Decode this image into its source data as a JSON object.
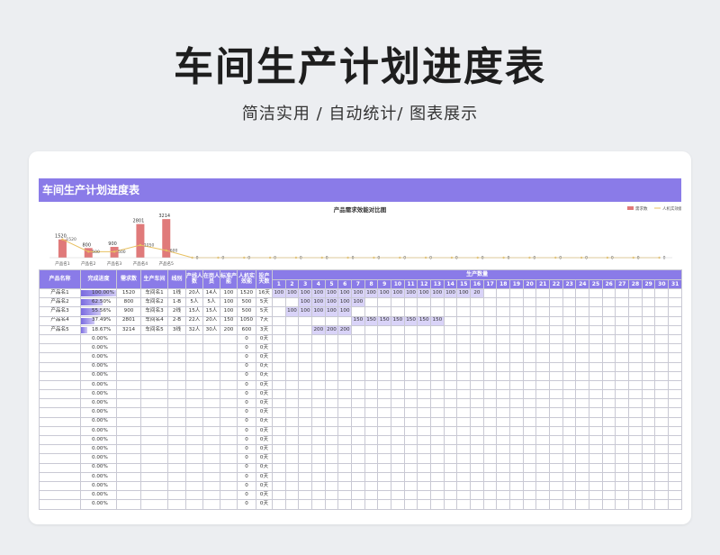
{
  "header": {
    "title": "车间生产计划进度表",
    "subtitle": "简洁实用 / 自动统计/ 图表展示"
  },
  "sheet": {
    "title": "车间生产计划进度表"
  },
  "chart_data": {
    "type": "bar",
    "title": "产品需求效能对比图",
    "categories": [
      "产品名1",
      "产品名2",
      "产品名3",
      "产品名4",
      "产品名5",
      "",
      "",
      "",
      "",
      "",
      "",
      "",
      "",
      "",
      "",
      "",
      "",
      "",
      "",
      "",
      "",
      "",
      "",
      ""
    ],
    "series": [
      {
        "name": "需求数",
        "type": "bar",
        "values": [
          1520,
          800,
          900,
          2801,
          3214,
          0,
          0,
          0,
          0,
          0,
          0,
          0,
          0,
          0,
          0,
          0,
          0,
          0,
          0,
          0,
          0,
          0,
          0,
          0
        ],
        "color": "#e07a7a"
      },
      {
        "name": "人机实效能",
        "type": "line",
        "values": [
          1520,
          500,
          500,
          1050,
          600,
          0,
          0,
          0,
          0,
          0,
          0,
          0,
          0,
          0,
          0,
          0,
          0,
          0,
          0,
          0,
          0,
          0,
          0,
          0
        ],
        "color": "#e8c060"
      }
    ],
    "bar_labels": [
      "1520",
      "800",
      "900",
      "2801",
      "3214"
    ],
    "line_labels": [
      "1520",
      "500",
      "500",
      "1050",
      "600",
      "0",
      "0",
      "0",
      "0",
      "0",
      "0",
      "0",
      "0",
      "0",
      "0",
      "0",
      "0",
      "0",
      "0",
      "0",
      "0",
      "0",
      "0",
      "0"
    ],
    "legend_position": "top-right",
    "ylim": [
      0,
      3600
    ],
    "grid": false
  },
  "table": {
    "headers": {
      "name": "产品名称",
      "progress": "完成进度",
      "demand": "需求数",
      "workshop": "生产车间",
      "line": "线别",
      "line_people": "产线人数",
      "on_duty": "在岗人员",
      "std_capacity": "标准产能",
      "machine_eff": "人机实效能",
      "days": "投产天数",
      "production_qty": "生产数量"
    },
    "day_numbers": [
      "1",
      "2",
      "3",
      "4",
      "5",
      "6",
      "7",
      "8",
      "9",
      "10",
      "11",
      "12",
      "13",
      "14",
      "15",
      "16",
      "17",
      "18",
      "19",
      "20",
      "21",
      "22",
      "23",
      "24",
      "25",
      "26",
      "27",
      "28",
      "29",
      "30",
      "31"
    ],
    "rows": [
      {
        "name": "产品名1",
        "progress": "100.00%",
        "pct": 1.0,
        "demand": "1520",
        "workshop": "车间名1",
        "line": "1线",
        "line_people": "20人",
        "on_duty": "14人",
        "std_capacity": "100",
        "machine_eff": "1520",
        "days": "16天",
        "daily": [
          "100",
          "100",
          "100",
          "100",
          "100",
          "100",
          "100",
          "100",
          "100",
          "100",
          "100",
          "100",
          "100",
          "100",
          "100",
          "20",
          "",
          "",
          "",
          "",
          "",
          "",
          "",
          "",
          "",
          "",
          "",
          "",
          "",
          "",
          ""
        ]
      },
      {
        "name": "产品名2",
        "progress": "62.50%",
        "pct": 0.625,
        "demand": "800",
        "workshop": "车间名2",
        "line": "1-B",
        "line_people": "5人",
        "on_duty": "5人",
        "std_capacity": "100",
        "machine_eff": "500",
        "days": "5天",
        "daily": [
          "",
          "",
          "100",
          "100",
          "100",
          "100",
          "100",
          "",
          "",
          "",
          "",
          "",
          "",
          "",
          "",
          "",
          "",
          "",
          "",
          "",
          "",
          "",
          "",
          "",
          "",
          "",
          "",
          "",
          "",
          "",
          ""
        ]
      },
      {
        "name": "产品名3",
        "progress": "55.56%",
        "pct": 0.5556,
        "demand": "900",
        "workshop": "车间名3",
        "line": "2线",
        "line_people": "15人",
        "on_duty": "15人",
        "std_capacity": "100",
        "machine_eff": "500",
        "days": "5天",
        "daily": [
          "",
          "100",
          "100",
          "100",
          "100",
          "100",
          "",
          "",
          "",
          "",
          "",
          "",
          "",
          "",
          "",
          "",
          "",
          "",
          "",
          "",
          "",
          "",
          "",
          "",
          "",
          "",
          "",
          "",
          "",
          "",
          ""
        ]
      },
      {
        "name": "产品名4",
        "progress": "37.49%",
        "pct": 0.3749,
        "demand": "2801",
        "workshop": "车间名4",
        "line": "2-B",
        "line_people": "22人",
        "on_duty": "20人",
        "std_capacity": "150",
        "machine_eff": "1050",
        "days": "7天",
        "daily": [
          "",
          "",
          "",
          "",
          "",
          "",
          "150",
          "150",
          "150",
          "150",
          "150",
          "150",
          "150",
          "",
          "",
          "",
          "",
          "",
          "",
          "",
          "",
          "",
          "",
          "",
          "",
          "",
          "",
          "",
          "",
          "",
          ""
        ]
      },
      {
        "name": "产品名5",
        "progress": "18.67%",
        "pct": 0.1867,
        "demand": "3214",
        "workshop": "车间名5",
        "line": "3线",
        "line_people": "32人",
        "on_duty": "30人",
        "std_capacity": "200",
        "machine_eff": "600",
        "days": "3天",
        "daily": [
          "",
          "",
          "",
          "200",
          "200",
          "200",
          "",
          "",
          "",
          "",
          "",
          "",
          "",
          "",
          "",
          "",
          "",
          "",
          "",
          "",
          "",
          "",
          "",
          "",
          "",
          "",
          "",
          "",
          "",
          "",
          ""
        ]
      }
    ],
    "empty_rows": {
      "count": 19,
      "progress": "0.00%",
      "pct": 0,
      "machine_eff": "0",
      "days": "0天"
    }
  }
}
